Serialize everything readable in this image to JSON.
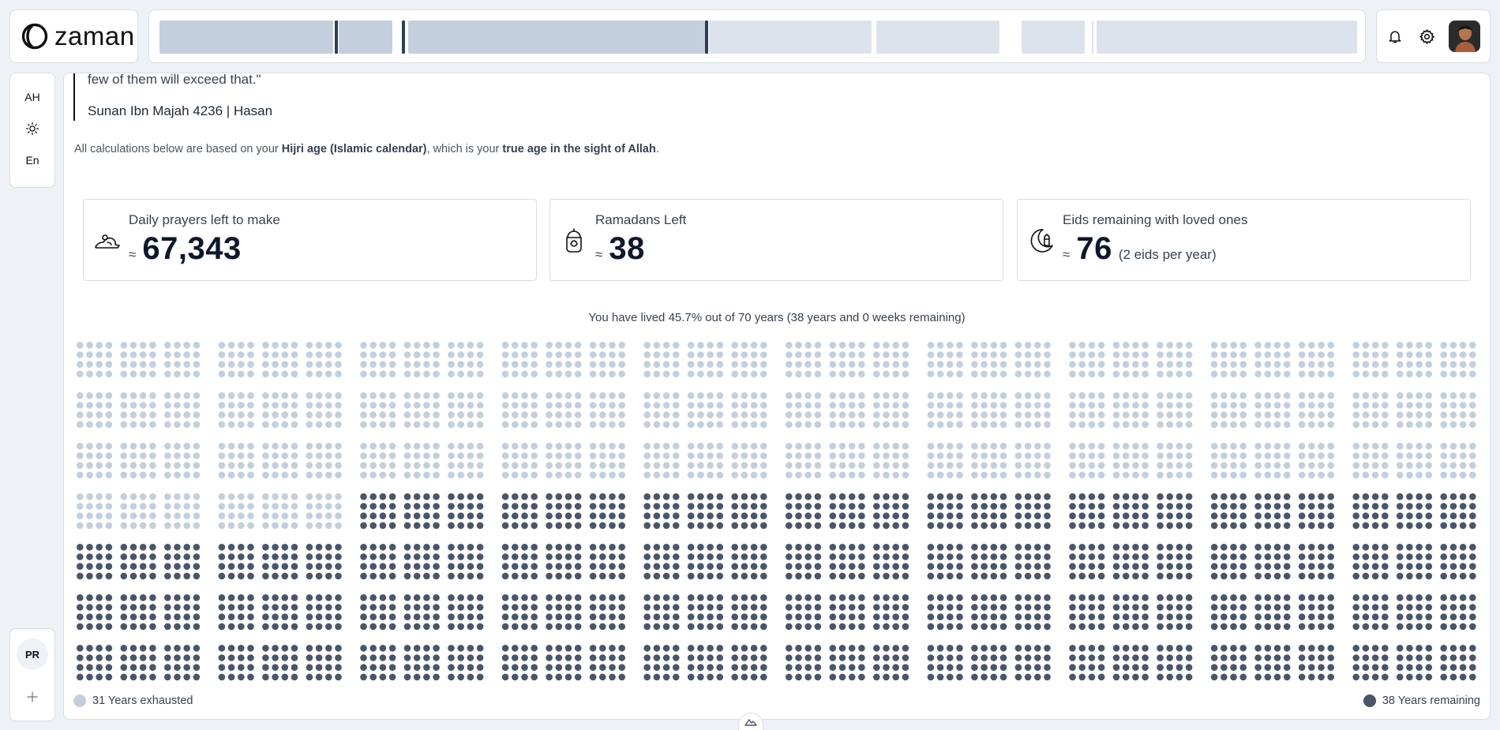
{
  "app": {
    "name": "zaman"
  },
  "header": {
    "nav_segments": [
      {
        "color": "#c3cfdc"
      },
      {
        "color": "#c3cfdc"
      },
      {
        "color": "#c3cfdc"
      },
      {
        "color": "#dde3ec"
      },
      {
        "color": "#dde3ec"
      },
      {
        "color": "#dde3ec"
      },
      {
        "color": "#dde3ec"
      }
    ],
    "icons": [
      "bell-icon",
      "gear-icon",
      "avatar"
    ]
  },
  "sidebar": {
    "calendar_toggle": "AH",
    "theme_icon": "sun-icon",
    "language": "En",
    "profile_badge": "PR",
    "add_icon": "plus-icon"
  },
  "main": {
    "quote_line": "few of them will exceed that.\"",
    "quote_source": "Sunan Ibn Majah 4236 | Hasan",
    "note_prefix": "All calculations below are based on your ",
    "note_bold1": "Hijri age (Islamic calendar)",
    "note_mid": ", which is your ",
    "note_bold2": "true age in the sight of Allah",
    "note_suffix": ".",
    "stats": [
      {
        "label": "Daily prayers left to make",
        "approx": "≈",
        "value": "67,343",
        "extra": "",
        "icon": "prayer-icon"
      },
      {
        "label": "Ramadans Left",
        "approx": "≈",
        "value": "38",
        "extra": "",
        "icon": "lantern-icon"
      },
      {
        "label": "Eids remaining with loved ones",
        "approx": "≈",
        "value": "76",
        "extra": "(2 eids per year)",
        "icon": "crescent-icon"
      }
    ],
    "summary": "You have lived 45.7% out of 70 years (38 years and 0 weeks remaining)",
    "legend_exhausted": "31 Years exhausted",
    "legend_remaining": "38 Years remaining"
  },
  "life_grid": {
    "total_years": 70,
    "years_lived_display": 31,
    "lived_fraction": 0.457,
    "dots_per_year": 48,
    "colors": {
      "lived": "#c3cfdc",
      "remaining": "#4a5568"
    }
  }
}
